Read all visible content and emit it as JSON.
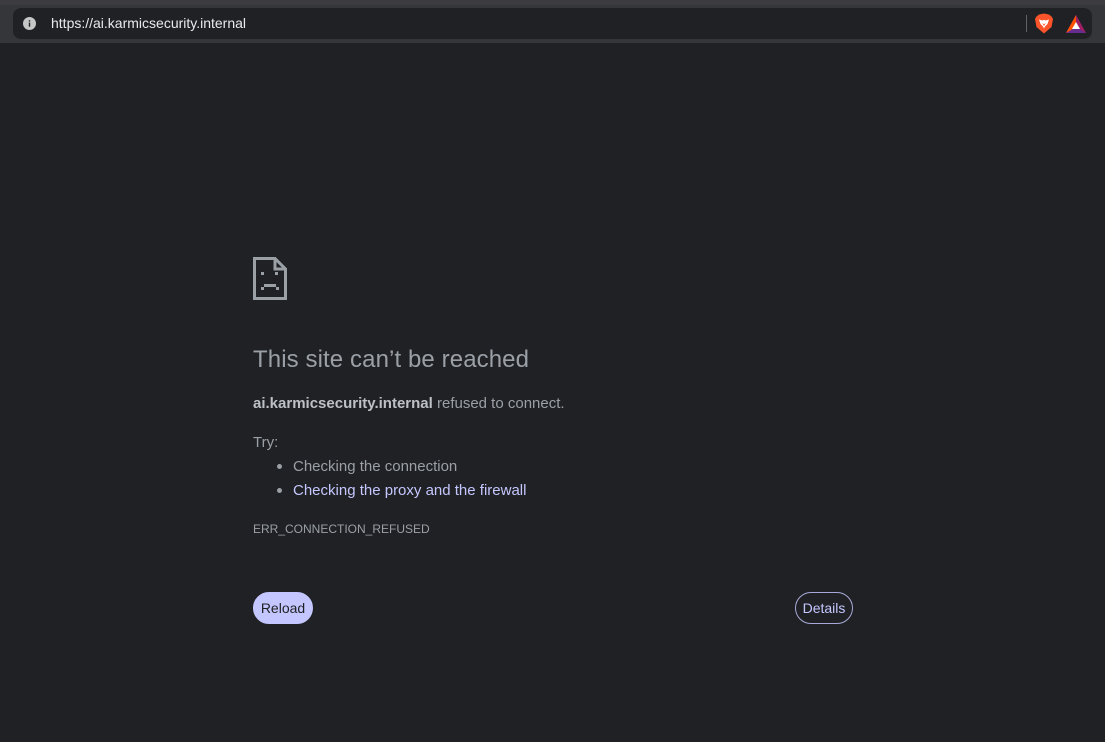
{
  "browser": {
    "url": "https://ai.karmicsecurity.internal",
    "icons": [
      "info-icon",
      "brave-shields-icon",
      "brave-rewards-icon"
    ]
  },
  "error_page": {
    "icon": "sad-document-icon",
    "title": "This site can’t be reached",
    "host": "ai.karmicsecurity.internal",
    "summary_suffix": " refused to connect.",
    "try_label": "Try:",
    "suggestions": [
      {
        "text": "Checking the connection",
        "link": false
      },
      {
        "text": "Checking the proxy and the firewall",
        "link": true
      }
    ],
    "error_code": "ERR_CONNECTION_REFUSED",
    "reload_label": "Reload",
    "details_label": "Details"
  },
  "colors": {
    "background": "#202124",
    "toolbar": "#35363a",
    "text": "#9aa0a6",
    "accent": "#c4c7ff",
    "brave_orange": "#fb542b"
  }
}
